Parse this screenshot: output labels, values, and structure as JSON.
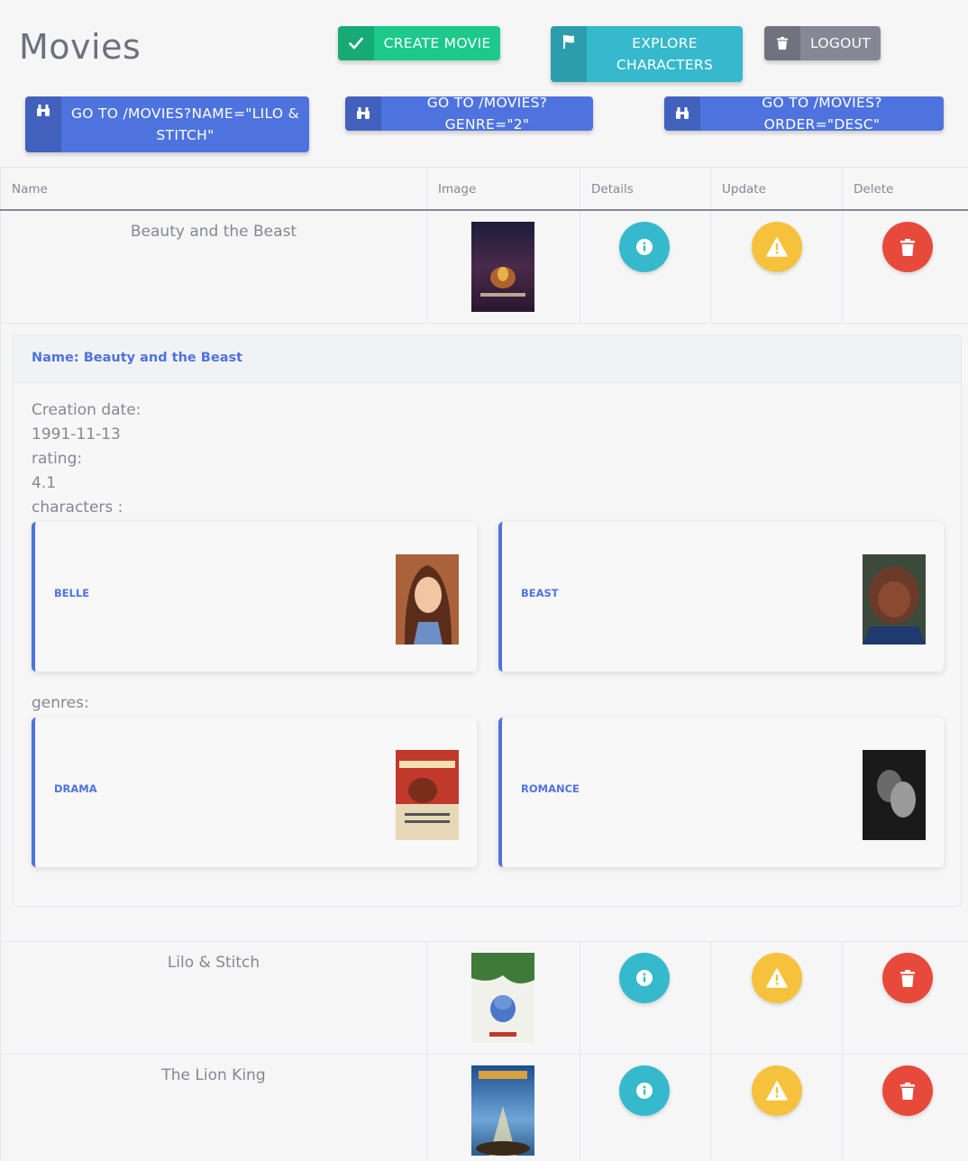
{
  "page_title": "Movies",
  "toolbar": {
    "create_movie": "CREATE MOVIE",
    "explore_characters": "EXPLORE CHARACTERS",
    "logout": "LOGOUT",
    "go_name": "GO TO /MOVIES?NAME=\"LILO & STITCH\"",
    "go_genre": "GO TO /MOVIES?GENRE=\"2\"",
    "go_order": "GO TO /MOVIES?ORDER=\"DESC\""
  },
  "table": {
    "headers": [
      "Name",
      "Image",
      "Details",
      "Update",
      "Delete"
    ],
    "rows": [
      {
        "name": "Beauty and the Beast"
      },
      {
        "name": "Lilo & Stitch"
      },
      {
        "name": "The Lion King"
      }
    ]
  },
  "detail": {
    "header": "Name: Beauty and the Beast",
    "creation_label": "Creation date:",
    "creation_value": "1991-11-13",
    "rating_label": "rating:",
    "rating_value": "4.1",
    "characters_label": "characters :",
    "characters": [
      "BELLE",
      "BEAST"
    ],
    "genres_label": "genres:",
    "genres": [
      "DRAMA",
      "ROMANCE"
    ]
  },
  "colors": {
    "primary": "#4e73df",
    "success": "#1cc88a",
    "info": "#36b9cc",
    "warning": "#f6c23e",
    "danger": "#e74a3b",
    "secondary": "#858796"
  },
  "icons": [
    "check-icon",
    "flag-icon",
    "trash-icon",
    "binoculars-icon",
    "info-icon",
    "warning-icon"
  ]
}
